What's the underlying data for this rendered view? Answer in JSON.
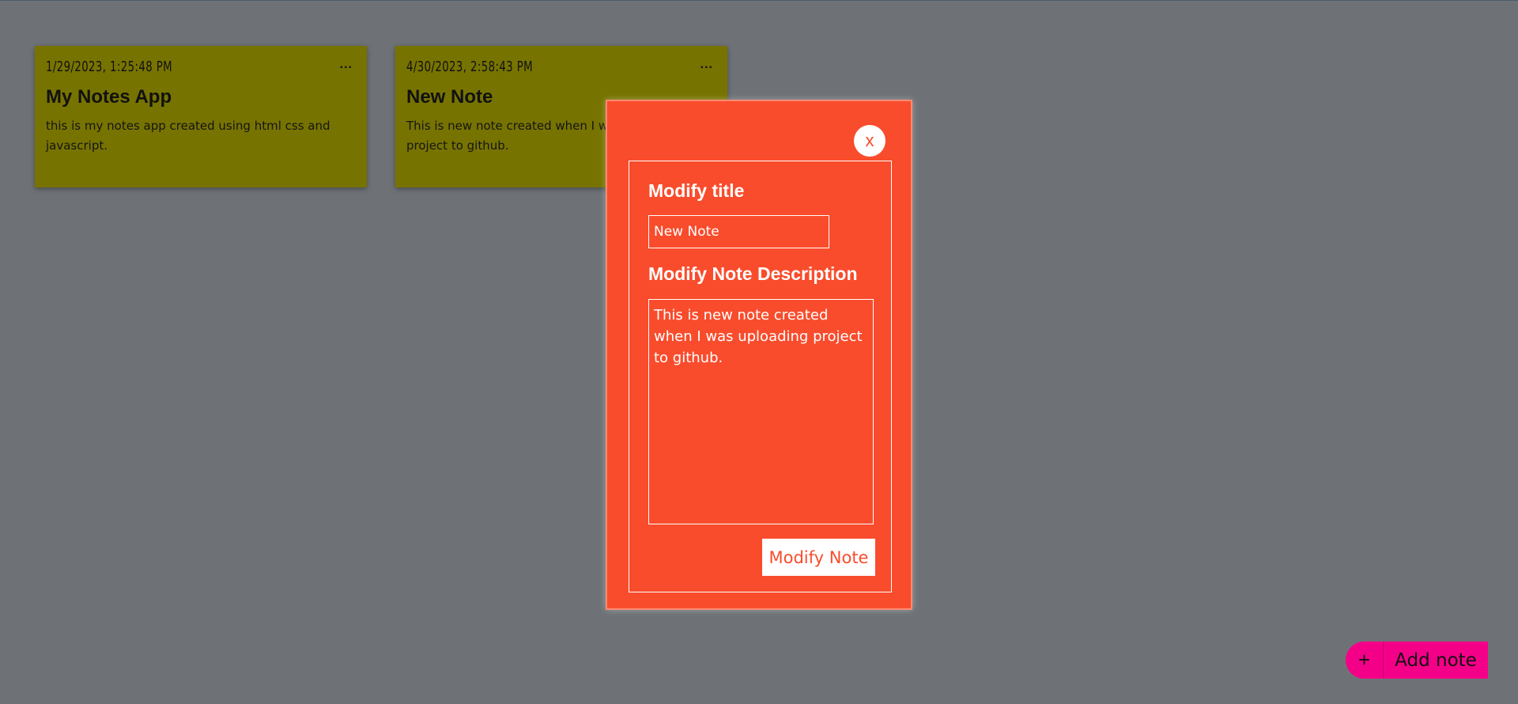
{
  "notes": [
    {
      "date": "1/29/2023, 1:25:48 PM",
      "menu": "...",
      "title": "My Notes App",
      "description": "this is my notes app created using html css and javascript."
    },
    {
      "date": "4/30/2023, 2:58:43 PM",
      "menu": "...",
      "title": "New Note",
      "description": "This is new note created when I was uploading project to github."
    }
  ],
  "modal": {
    "close_label": "x",
    "title_label": "Modify title",
    "title_value": "New Note",
    "desc_label": "Modify Note Description",
    "desc_value": "This is new note created when I was uploading project to github.",
    "submit_label": "Modify Note"
  },
  "fab": {
    "plus": "+",
    "label": "Add note"
  },
  "colors": {
    "background": "#6e7276",
    "note": "#777300",
    "modal": "#f94c2c",
    "fab": "#f40088"
  }
}
